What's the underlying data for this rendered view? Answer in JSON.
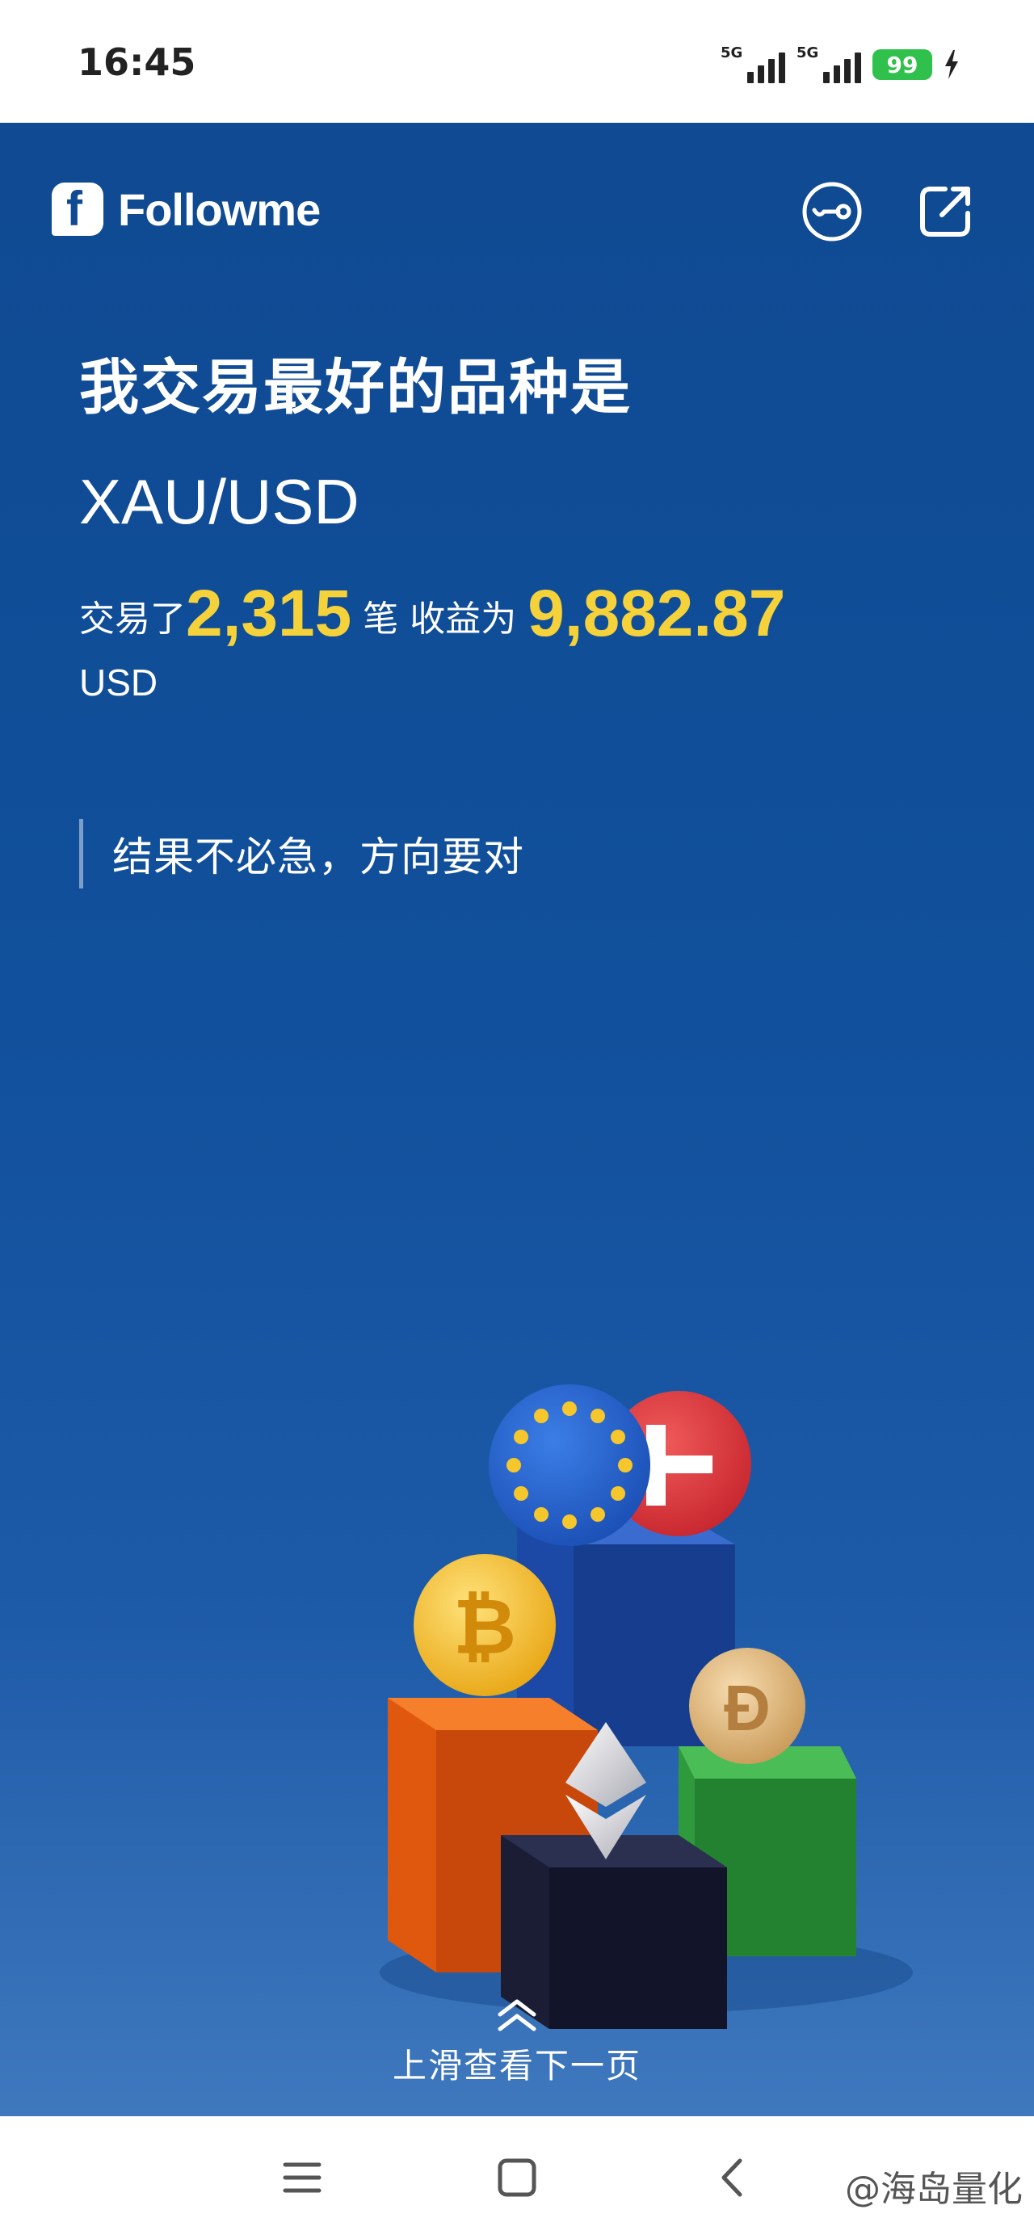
{
  "status_bar": {
    "time": "16:45",
    "signal_1_label": "5G",
    "signal_2_label": "5G",
    "battery_level": "99",
    "charging": true
  },
  "header": {
    "brand_name": "Followme",
    "logo_icon": "followme-logo-icon",
    "icons": [
      "eye-slash-icon",
      "share-icon"
    ]
  },
  "content": {
    "headline": "我交易最好的品种是",
    "symbol": "XAU/USD",
    "trades_prefix": "交易了",
    "trades_count": "2,315",
    "trades_suffix": "笔 收益为",
    "profit_value": "9,882.87",
    "profit_unit": "USD",
    "quote": "结果不必急，方向要对"
  },
  "footer_hint": {
    "icon": "double-chevron-up-icon",
    "label": "上滑查看下一页"
  },
  "nav_bar": {
    "icons": [
      "menu-icon",
      "home-square-icon",
      "back-icon"
    ],
    "watermark": "@海岛量化"
  },
  "colors": {
    "background_top": "#0f4a92",
    "background_bottom": "#3f78bd",
    "highlight": "#f6d23a",
    "battery": "#2fc14b"
  }
}
